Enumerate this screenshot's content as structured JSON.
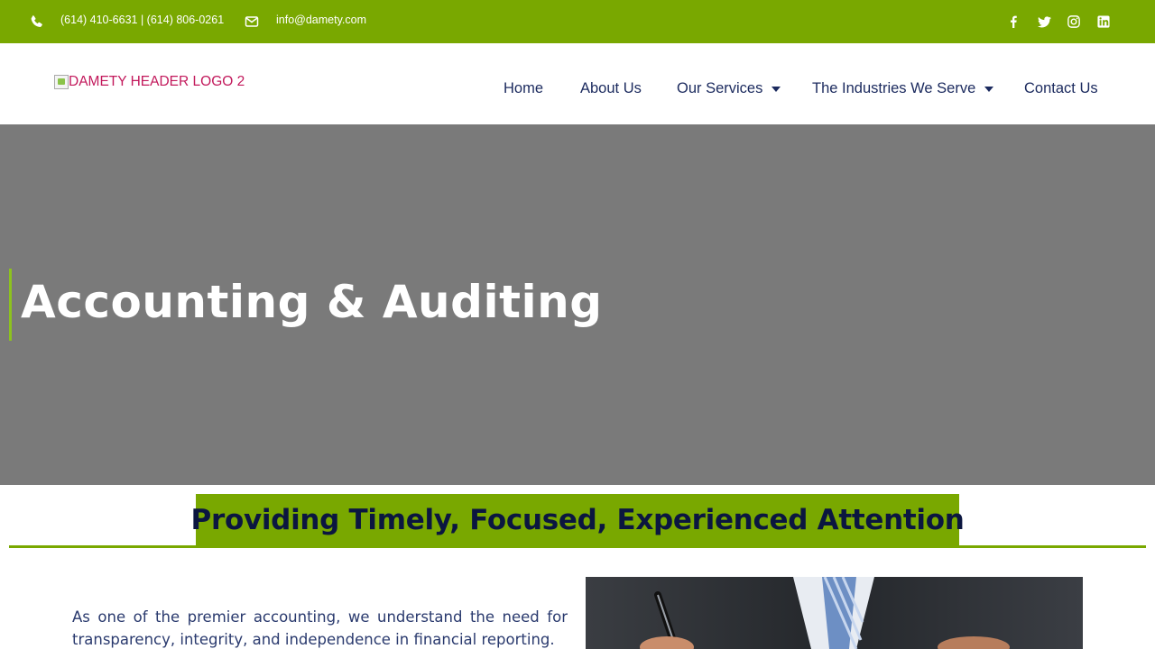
{
  "topbar": {
    "phone": "(614) 410-6631 | (614) 806-0261",
    "email": "info@damety.com",
    "social": [
      "facebook-icon",
      "twitter-icon",
      "instagram-icon",
      "linkedin-icon"
    ],
    "bg_color": "#79a800"
  },
  "header": {
    "logo_alt": "DAMETY HEADER LOGO 2",
    "nav": {
      "home": "Home",
      "about": "About Us",
      "services": "Our Services",
      "industries": "The Industries We Serve",
      "contact": "Contact Us"
    }
  },
  "hero": {
    "title": "Accounting & Auditing"
  },
  "section": {
    "tagline": "Providing Timely, Focused, Experienced Attention",
    "intro": "As one of the premier accounting, we understand the need for transparency, integrity, and independence in financial reporting."
  },
  "colors": {
    "accent_green": "#79a800",
    "nav_text": "#1b2a5e",
    "hero_bg": "#7a7a7a"
  }
}
